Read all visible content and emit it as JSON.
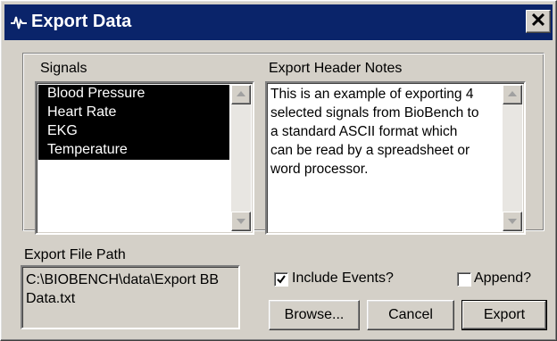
{
  "window": {
    "title": "Export Data",
    "close_glyph": "✕",
    "icon": "waveform-icon",
    "colors": {
      "titlebar": "#0a246a",
      "face": "#d4d0c8",
      "selection": "#000000"
    }
  },
  "signals": {
    "label": "Signals",
    "items": [
      "Blood Pressure",
      "Heart Rate",
      "EKG",
      "Temperature"
    ]
  },
  "notes": {
    "label": "Export Header Notes",
    "text": "This is an example of exporting 4\nselected signals from BioBench to\na standard ASCII format which\ncan be read by a spreadsheet or\nword processor."
  },
  "export_path": {
    "label": "Export File Path",
    "value": "C:\\BIOBENCH\\data\\Export BB Data.txt"
  },
  "options": {
    "include_events_label": "Include Events?",
    "include_events_checked": true,
    "append_label": "Append?",
    "append_checked": false
  },
  "buttons": {
    "browse": "Browse...",
    "cancel": "Cancel",
    "export": "Export"
  }
}
